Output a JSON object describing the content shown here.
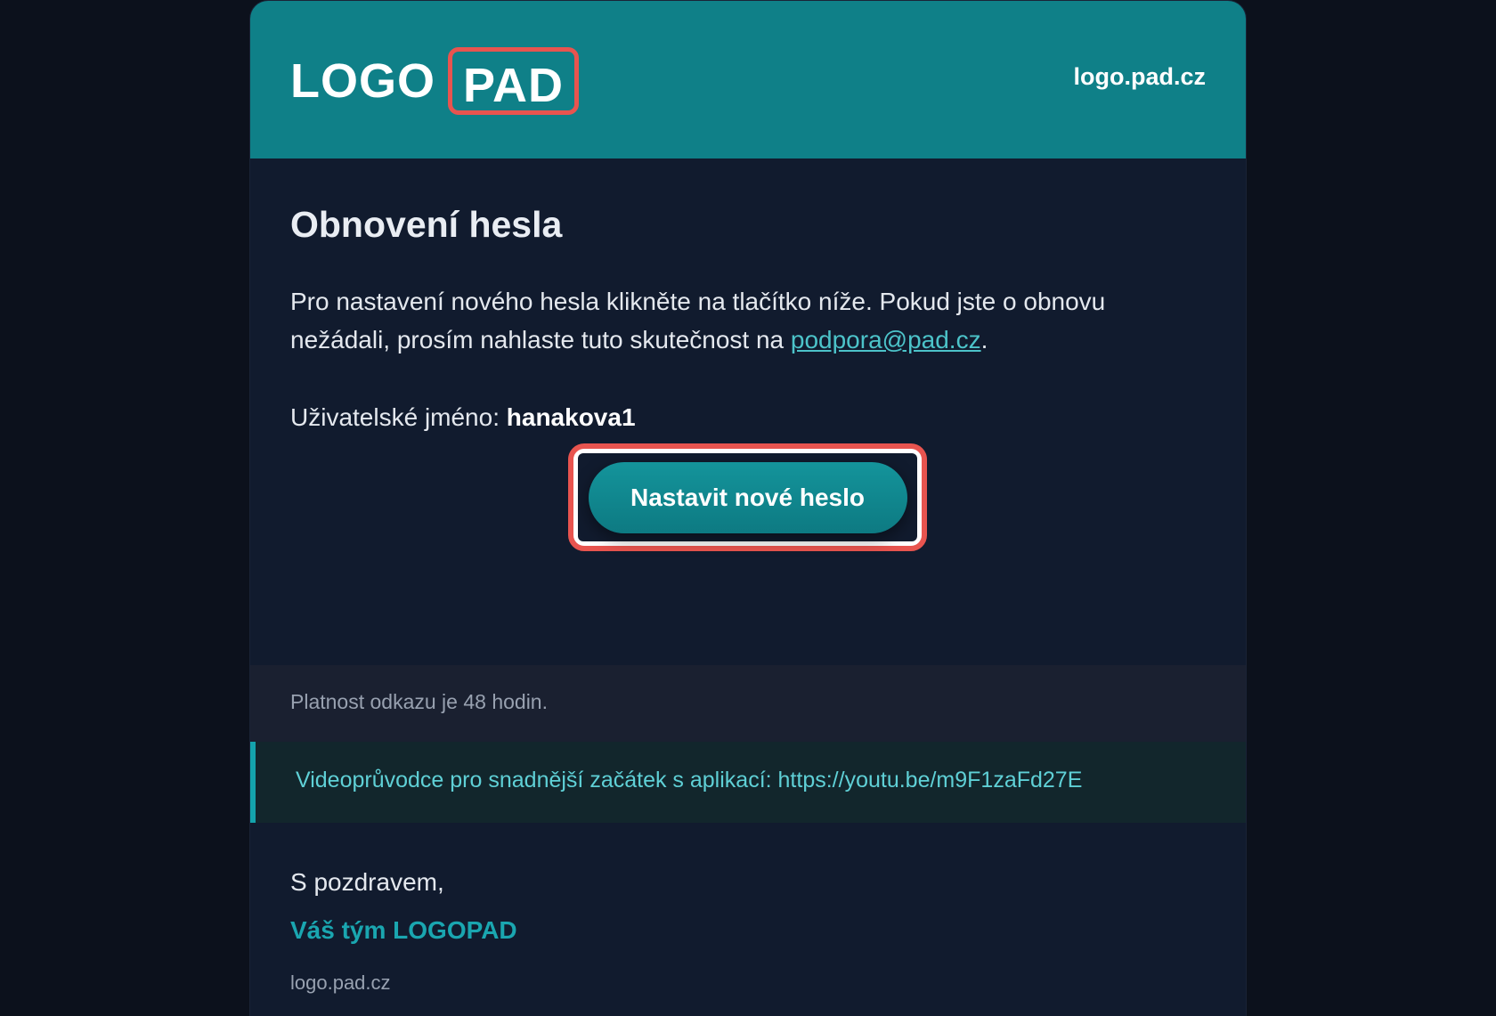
{
  "header": {
    "logo_left": "LOGO",
    "logo_right": "PAD",
    "domain": "logo.pad.cz"
  },
  "content": {
    "title": "Obnovení hesla",
    "intro_text": "Pro nastavení nového hesla klikněte na tlačítko níže. Pokud jste o obnovu nežádali, prosím nahlaste tuto skutečnost na ",
    "support_email": "podpora@pad.cz",
    "intro_end": ".",
    "username_label": "Uživatelské jméno: ",
    "username_value": "hanakova1",
    "button_label": "Nastavit nové heslo"
  },
  "validity_note": "Platnost odkazu je 48 hodin.",
  "video_note": "Videoprůvodce pro snadnější začátek s aplikací: https://youtu.be/m9F1zaFd27E",
  "signature": {
    "greeting": "S pozdravem,",
    "team": "Váš tým LOGOPAD",
    "domain": "logo.pad.cz"
  },
  "colors": {
    "header_bg": "#0f8088",
    "page_bg": "#0c111c",
    "card_bg": "#111b2e",
    "accent": "#1aa6b0",
    "highlight": "#e8544f"
  }
}
